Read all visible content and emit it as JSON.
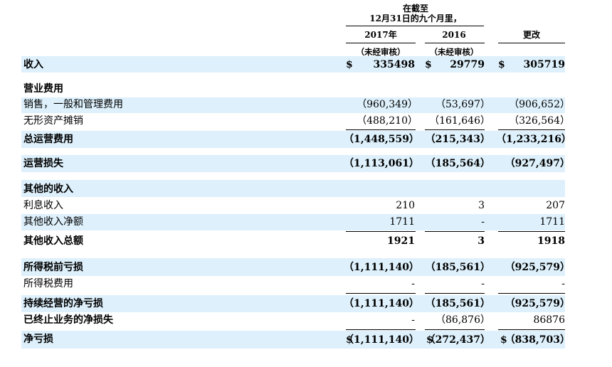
{
  "header": {
    "period_line1": "在截至",
    "period_line2": "12月31日的九个月里，",
    "col_2017": "2017年",
    "col_2016": "2016",
    "col_change": "更改",
    "unaudited_2017": "（未经审核）",
    "unaudited_2016": "（未经审核）"
  },
  "currency_symbol": "$",
  "rows": [
    {
      "label": "收入",
      "v2017": "335498",
      "v2016": "29779",
      "vchg": "305719"
    },
    {
      "label": "营业费用"
    },
    {
      "label": "销售，一般和管理费用",
      "v2017": "（960,349）",
      "v2016": "（53,697）",
      "vchg": "（906,652）"
    },
    {
      "label": "无形资产摊销",
      "v2017": "（488,210）",
      "v2016": "（161,646）",
      "vchg": "（326,564）"
    },
    {
      "label": "总运营费用",
      "v2017": "（1,448,559）",
      "v2016": "（215,343）",
      "vchg": "（1,233,216）"
    },
    {
      "label": "运营损失",
      "v2017": "（1,113,061）",
      "v2016": "（185,564）",
      "vchg": "（927,497）"
    },
    {
      "label": "其他的收入"
    },
    {
      "label": "利息收入",
      "v2017": "210",
      "v2016": "3",
      "vchg": "207"
    },
    {
      "label": "其他收入净额",
      "v2017": "1711",
      "v2016": "-",
      "vchg": "1711"
    },
    {
      "label": "其他收入总额",
      "v2017": "1921",
      "v2016": "3",
      "vchg": "1918"
    },
    {
      "label": "所得税前亏损",
      "v2017": "（1,111,140）",
      "v2016": "（185,561）",
      "vchg": "（925,579）"
    },
    {
      "label": "所得税费用",
      "v2017": "-",
      "v2016": "-",
      "vchg": "-"
    },
    {
      "label": "持续经营的净亏损",
      "v2017": "（1,111,140）",
      "v2016": "（185,561）",
      "vchg": "（925,579）"
    },
    {
      "label": "已终止业务的净损失",
      "v2017": "-",
      "v2016": "（86,876）",
      "vchg": "86876"
    },
    {
      "label": "净亏损",
      "v2017": "（1,111,140）",
      "v2016": "（272,437）",
      "vchg": "（838,703）"
    }
  ]
}
